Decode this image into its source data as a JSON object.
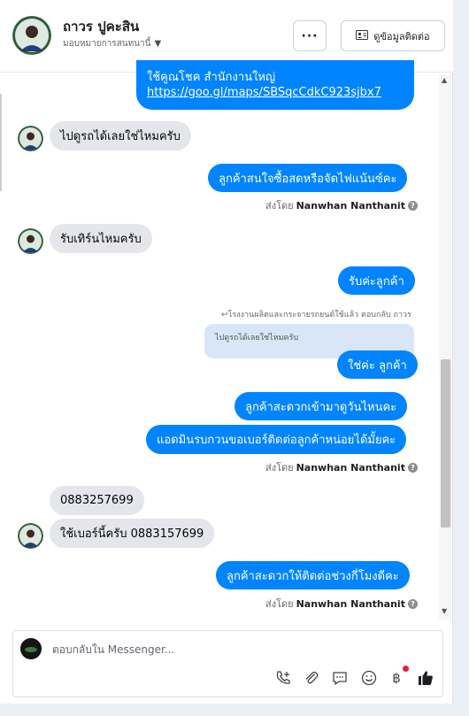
{
  "header": {
    "name": "ถาวร ปูคะสิน",
    "subtitle": "มอบหมายการสนทนานี้",
    "more_label": "···",
    "contact_label": "ดูข้อมูลติดต่อ"
  },
  "messages": {
    "m0_line1": "ใช้คูณโชค สำนักงานใหญ่",
    "m0_link": "https://goo.gl/maps/SBSqcCdkC923sjbx7",
    "m1": "ไปดูรถได้เลยใช่ไหมครับ",
    "m2": "ลูกค้าสนใจซื้อสดหรือจัดไฟแน้นซ์คะ",
    "m3": "รับเทิร์นไหมครับ",
    "m4": "รับค่ะลูกค้า",
    "m5_reply_note": "โรงงานผลิตและกระจายรถยนต์ใช้แล้ว ตอบกลับ ถาวร",
    "m5_quoted": "ไปดูรถได้เลยใช่ไหมครับ",
    "m5": "ใช่ค่ะ ลูกค้า",
    "m6": "ลูกค้าสะดวกเข้ามาดูวันไหนคะ",
    "m7": "แอดมินรบกวนขอเบอร์ติดต่อลูกค้าหน่อยได้มั้ยคะ",
    "m8": "0883257699",
    "m9": "ใช้เบอร์นี้ครับ 0883157699",
    "m10": "ลูกค้าสะดวกให้ติดต่อช่วงกี่โมงดีคะ"
  },
  "sentby": {
    "prefix": "ส่งโดย",
    "name": "Nanwhan Nanthanit"
  },
  "composer": {
    "placeholder": "ตอบกลับใน Messenger..."
  },
  "icons": [
    "dropdown-caret-icon",
    "contact-card-icon",
    "add-call-icon",
    "attachment-icon",
    "saved-reply-icon",
    "emoji-icon",
    "baht-icon",
    "like-icon",
    "info-icon",
    "reply-arrow-icon"
  ],
  "colors": {
    "accent": "#0084ff",
    "incoming_bubble": "#e4e6eb",
    "notification": "#e41e3f"
  }
}
